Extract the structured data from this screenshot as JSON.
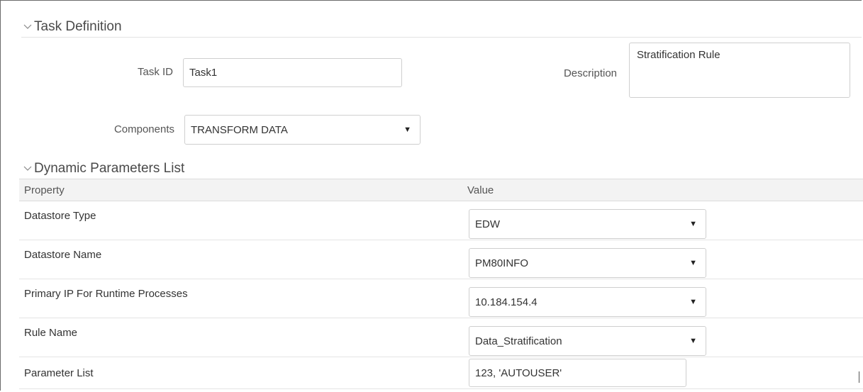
{
  "task_definition": {
    "header": "Task Definition",
    "task_id_label": "Task ID",
    "task_id_value": "Task1",
    "description_label": "Description",
    "description_value": "Stratification Rule",
    "components_label": "Components",
    "components_value": "TRANSFORM DATA"
  },
  "dynamic_params": {
    "header": "Dynamic Parameters List",
    "col_property": "Property",
    "col_value": "Value",
    "rows": [
      {
        "property": "Datastore Type",
        "value": "EDW"
      },
      {
        "property": "Datastore Name",
        "value": "PM80INFO"
      },
      {
        "property": "Primary IP For Runtime Processes",
        "value": "10.184.154.4"
      },
      {
        "property": "Rule Name",
        "value": "Data_Stratification"
      },
      {
        "property": "Parameter List",
        "value": "123, 'AUTOUSER'"
      }
    ]
  },
  "icons": {
    "dropdown": "▼",
    "collapse": "chevron-down-icon"
  }
}
